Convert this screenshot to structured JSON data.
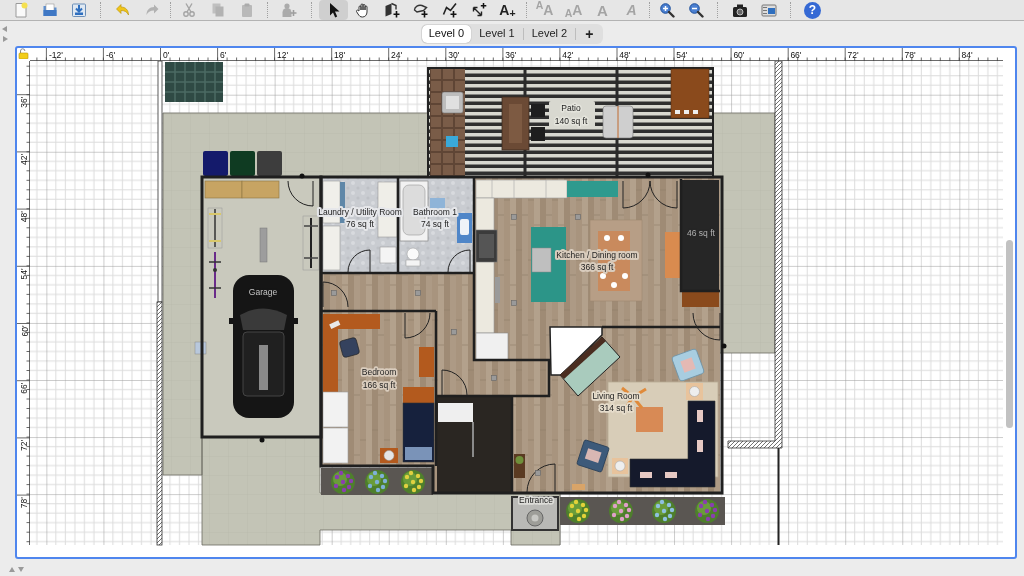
{
  "toolbar": {
    "groups": [
      [
        {
          "kind": "new",
          "disabled": false
        },
        {
          "kind": "open",
          "disabled": false
        },
        {
          "kind": "save",
          "disabled": false
        }
      ],
      [
        {
          "kind": "undo",
          "disabled": false
        },
        {
          "kind": "redo",
          "disabled": true
        }
      ],
      [
        {
          "kind": "cut",
          "disabled": true
        },
        {
          "kind": "copy",
          "disabled": true
        },
        {
          "kind": "paste",
          "disabled": true
        }
      ],
      [
        {
          "kind": "furniture",
          "disabled": true
        }
      ],
      [
        {
          "kind": "select",
          "disabled": false,
          "selected": true
        },
        {
          "kind": "pan",
          "disabled": false,
          "selected": false
        },
        {
          "kind": "walls",
          "disabled": false,
          "selected": false
        },
        {
          "kind": "rooms",
          "disabled": false,
          "selected": false
        },
        {
          "kind": "polylines",
          "disabled": false,
          "selected": false
        },
        {
          "kind": "dimensions",
          "disabled": false,
          "selected": false
        },
        {
          "kind": "text",
          "label": "A$_{+}$",
          "disabled": false,
          "selected": false
        }
      ],
      [
        {
          "kind": "grow",
          "label": "$^{A}$A",
          "disabled": true
        },
        {
          "kind": "shrink",
          "label": "$_{A}$A",
          "disabled": true
        },
        {
          "kind": "bold",
          "label": "A",
          "disabled": true
        },
        {
          "kind": "italic",
          "label": "A",
          "disabled": true
        }
      ],
      [
        {
          "kind": "zoomin",
          "disabled": false
        },
        {
          "kind": "zoomout",
          "disabled": false
        }
      ],
      [
        {
          "kind": "photo",
          "disabled": false
        },
        {
          "kind": "video",
          "disabled": false
        }
      ],
      [
        {
          "kind": "help",
          "label": "?",
          "disabled": false
        }
      ]
    ]
  },
  "levels": [
    {
      "label": "Level 0",
      "selected": true
    },
    {
      "label": "Level 1",
      "selected": false
    },
    {
      "label": "Level 2",
      "selected": false
    }
  ],
  "add_level": "+",
  "ruler_top": [
    "-12'",
    "-6'",
    "0'",
    "6'",
    "12'",
    "18'",
    "24'",
    "30'",
    "36'",
    "42'",
    "48'",
    "54'",
    "60'",
    "66'",
    "72'",
    "78'",
    "84'"
  ],
  "ruler_left": [
    "36'",
    "42'",
    "48'",
    "54'",
    "60'",
    "66'",
    "72'",
    "78'"
  ],
  "plan": {
    "rooms": [
      {
        "name": "Patio",
        "area": "140 sq ft"
      },
      {
        "name": "Laundry / Utility Room",
        "area": "76 sq ft"
      },
      {
        "name": "Bathroom 1",
        "area": "74 sq ft"
      },
      {
        "name": "Garage"
      },
      {
        "name": "Kitchen / Dining room",
        "area": "366 sq ft"
      },
      {
        "area": "46 sq ft"
      },
      {
        "name": "Bedroom",
        "area": "166 sq ft"
      },
      {
        "name": "Living Room",
        "area": "314 sq ft"
      },
      {
        "name": "Entrance"
      }
    ]
  }
}
